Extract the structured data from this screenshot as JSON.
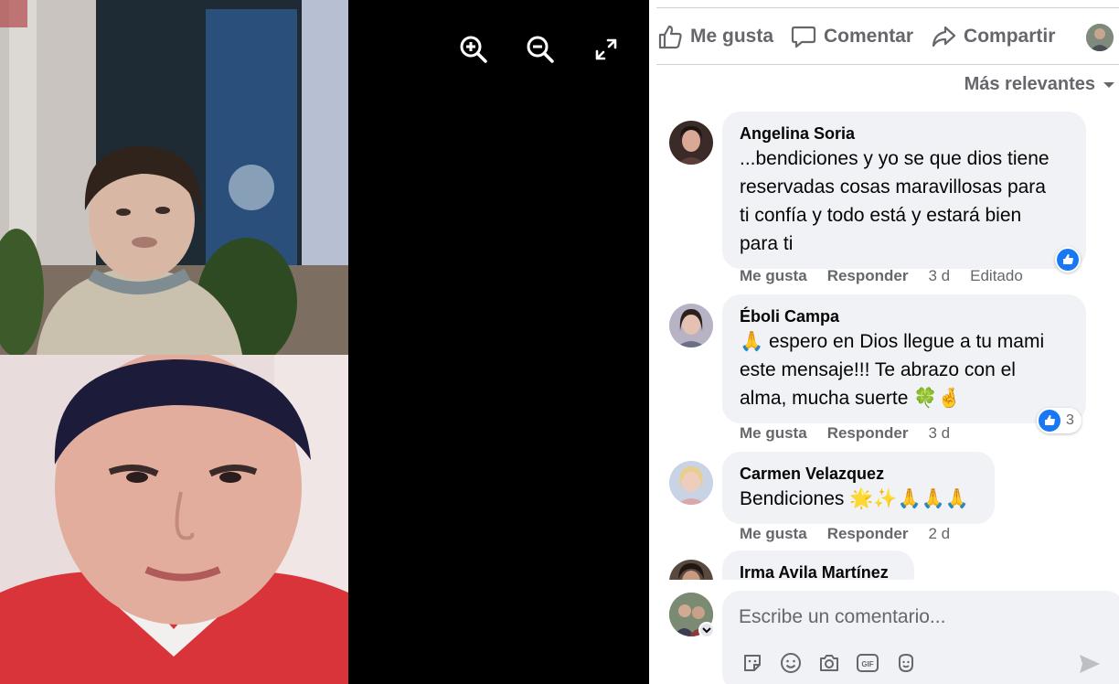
{
  "viewer": {
    "controls": [
      "zoom-in-icon",
      "zoom-out-icon",
      "fullscreen-icon"
    ]
  },
  "actions": {
    "like_label": "Me gusta",
    "comment_label": "Comentar",
    "share_label": "Compartir"
  },
  "sort": {
    "label": "Más relevantes"
  },
  "comments": [
    {
      "name": "Angelina Soria",
      "lines": [
        "...bendiciones y yo se que dios tiene",
        "reservadas cosas maravillosas para",
        "ti confía y todo está y estará bien",
        "para ti"
      ],
      "like": "Me gusta",
      "reply": "Responder",
      "time": "3 d",
      "edited": "Editado",
      "reactions": ""
    },
    {
      "name": "Éboli Campa",
      "lines": [
        "🙏 espero en Dios llegue a tu mami",
        "este mensaje!!! Te abrazo con el",
        "alma, mucha suerte 🍀🤞"
      ],
      "like": "Me gusta",
      "reply": "Responder",
      "time": "3 d",
      "reactions": "3"
    },
    {
      "name": "Carmen Velazquez",
      "lines": [
        "Bendiciones 🌟✨🙏🙏🙏"
      ],
      "like": "Me gusta",
      "reply": "Responder",
      "time": "2 d"
    },
    {
      "name": "Irma Avila Martínez",
      "lines": []
    }
  ],
  "composer": {
    "placeholder": "Escribe un comentario...",
    "tools": [
      "sticker-icon",
      "emoji-icon",
      "camera-icon",
      "gif-icon",
      "avatar-sticker-icon"
    ]
  },
  "colors": {
    "accent": "#1877f2",
    "secondary_text": "#65676b",
    "bubble": "#f0f2f5"
  }
}
